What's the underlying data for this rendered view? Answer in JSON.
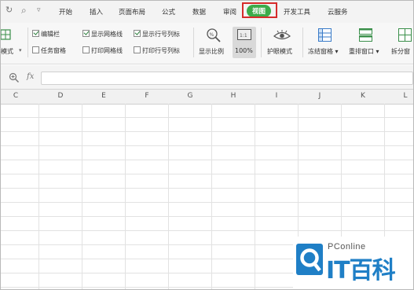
{
  "quick_access": {
    "icons": [
      "redo-icon",
      "search-icon",
      "dropdown-icon"
    ]
  },
  "tabs": [
    {
      "label": "开始"
    },
    {
      "label": "插入"
    },
    {
      "label": "页面布局"
    },
    {
      "label": "公式"
    },
    {
      "label": "数据"
    },
    {
      "label": "审阅"
    },
    {
      "label": "视图",
      "active": true
    },
    {
      "label": "开发工具"
    },
    {
      "label": "云服务"
    }
  ],
  "ribbon": {
    "mode_fragment": "模式",
    "checkboxes": {
      "edit_bar": {
        "label": "编辑栏",
        "checked": true
      },
      "task_pane": {
        "label": "任务窗格",
        "checked": false
      },
      "show_gridlines": {
        "label": "显示网格线",
        "checked": true
      },
      "print_gridlines": {
        "label": "打印网格线",
        "checked": false
      },
      "show_headers": {
        "label": "显示行号列标",
        "checked": true
      },
      "print_headers": {
        "label": "打印行号列标",
        "checked": false
      }
    },
    "zoom_ratio_label": "显示比例",
    "zoom_value": "100%",
    "eye_mode_label": "护眼模式",
    "freeze_panes_label": "冻结窗格",
    "arrange_windows_label": "重排窗口",
    "split_window_label": "拆分窗"
  },
  "formula_bar": {
    "fx_label": "fx",
    "value": ""
  },
  "columns": [
    "C",
    "D",
    "E",
    "F",
    "G",
    "H",
    "I",
    "J",
    "K",
    "L"
  ],
  "watermark": {
    "brand": "PConline",
    "chinese": "IT百科"
  },
  "colors": {
    "active_tab": "#3cab4a",
    "highlight_box": "#d62b2b",
    "watermark_blue": "#1f7fc6"
  }
}
